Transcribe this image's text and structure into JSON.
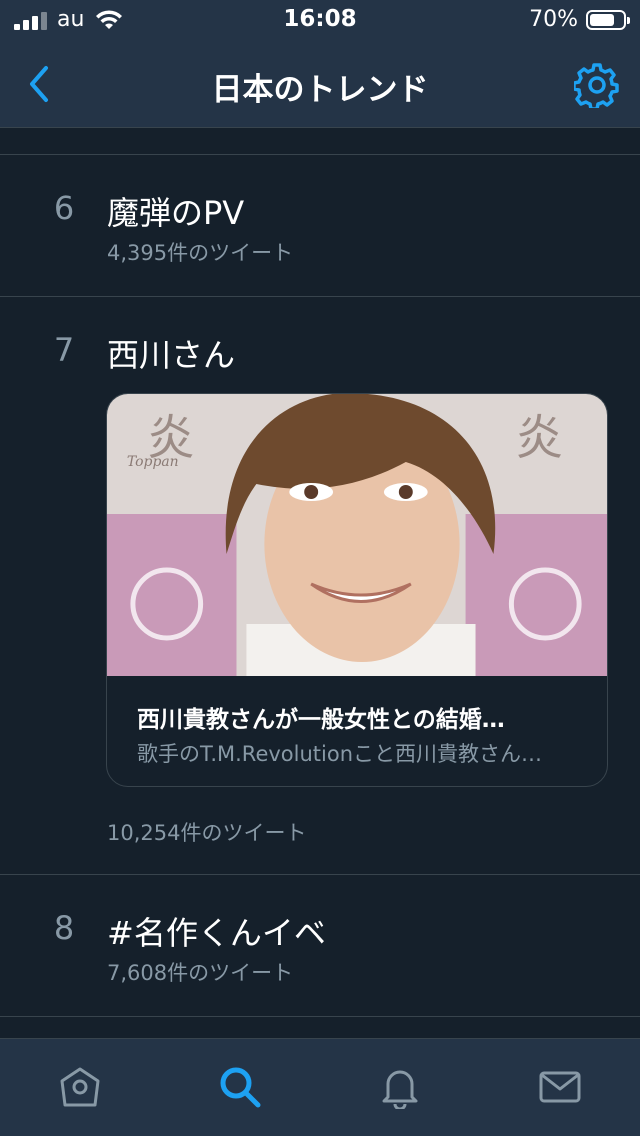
{
  "status": {
    "carrier": "au",
    "time": "16:08",
    "battery": "70%"
  },
  "nav": {
    "title": "日本のトレンド",
    "back_icon": "chevron-left-icon",
    "settings_icon": "gear-icon"
  },
  "trends": [
    {
      "rank": "6",
      "name": "魔弾のPV",
      "count": "4,395件のツイート"
    },
    {
      "rank": "7",
      "name": "西川さん",
      "count": "10,254件のツイート",
      "card": {
        "title": "西川貴教さんが一般女性との結婚…",
        "description": "歌手のT.M.Revolutionこと西川貴教さん…",
        "image_label": "Toppan"
      }
    },
    {
      "rank": "8",
      "name": "#名作くんイベ",
      "count": "7,608件のツイート"
    }
  ],
  "tabs": [
    {
      "name": "home",
      "icon": "home-icon"
    },
    {
      "name": "search",
      "icon": "search-icon",
      "active": true
    },
    {
      "name": "notifications",
      "icon": "bell-icon"
    },
    {
      "name": "messages",
      "icon": "mail-icon"
    }
  ],
  "colors": {
    "background": "#15202b",
    "bar": "#243447",
    "accent": "#1da1f2",
    "secondary_text": "#8899a6",
    "divider": "#38444d"
  }
}
